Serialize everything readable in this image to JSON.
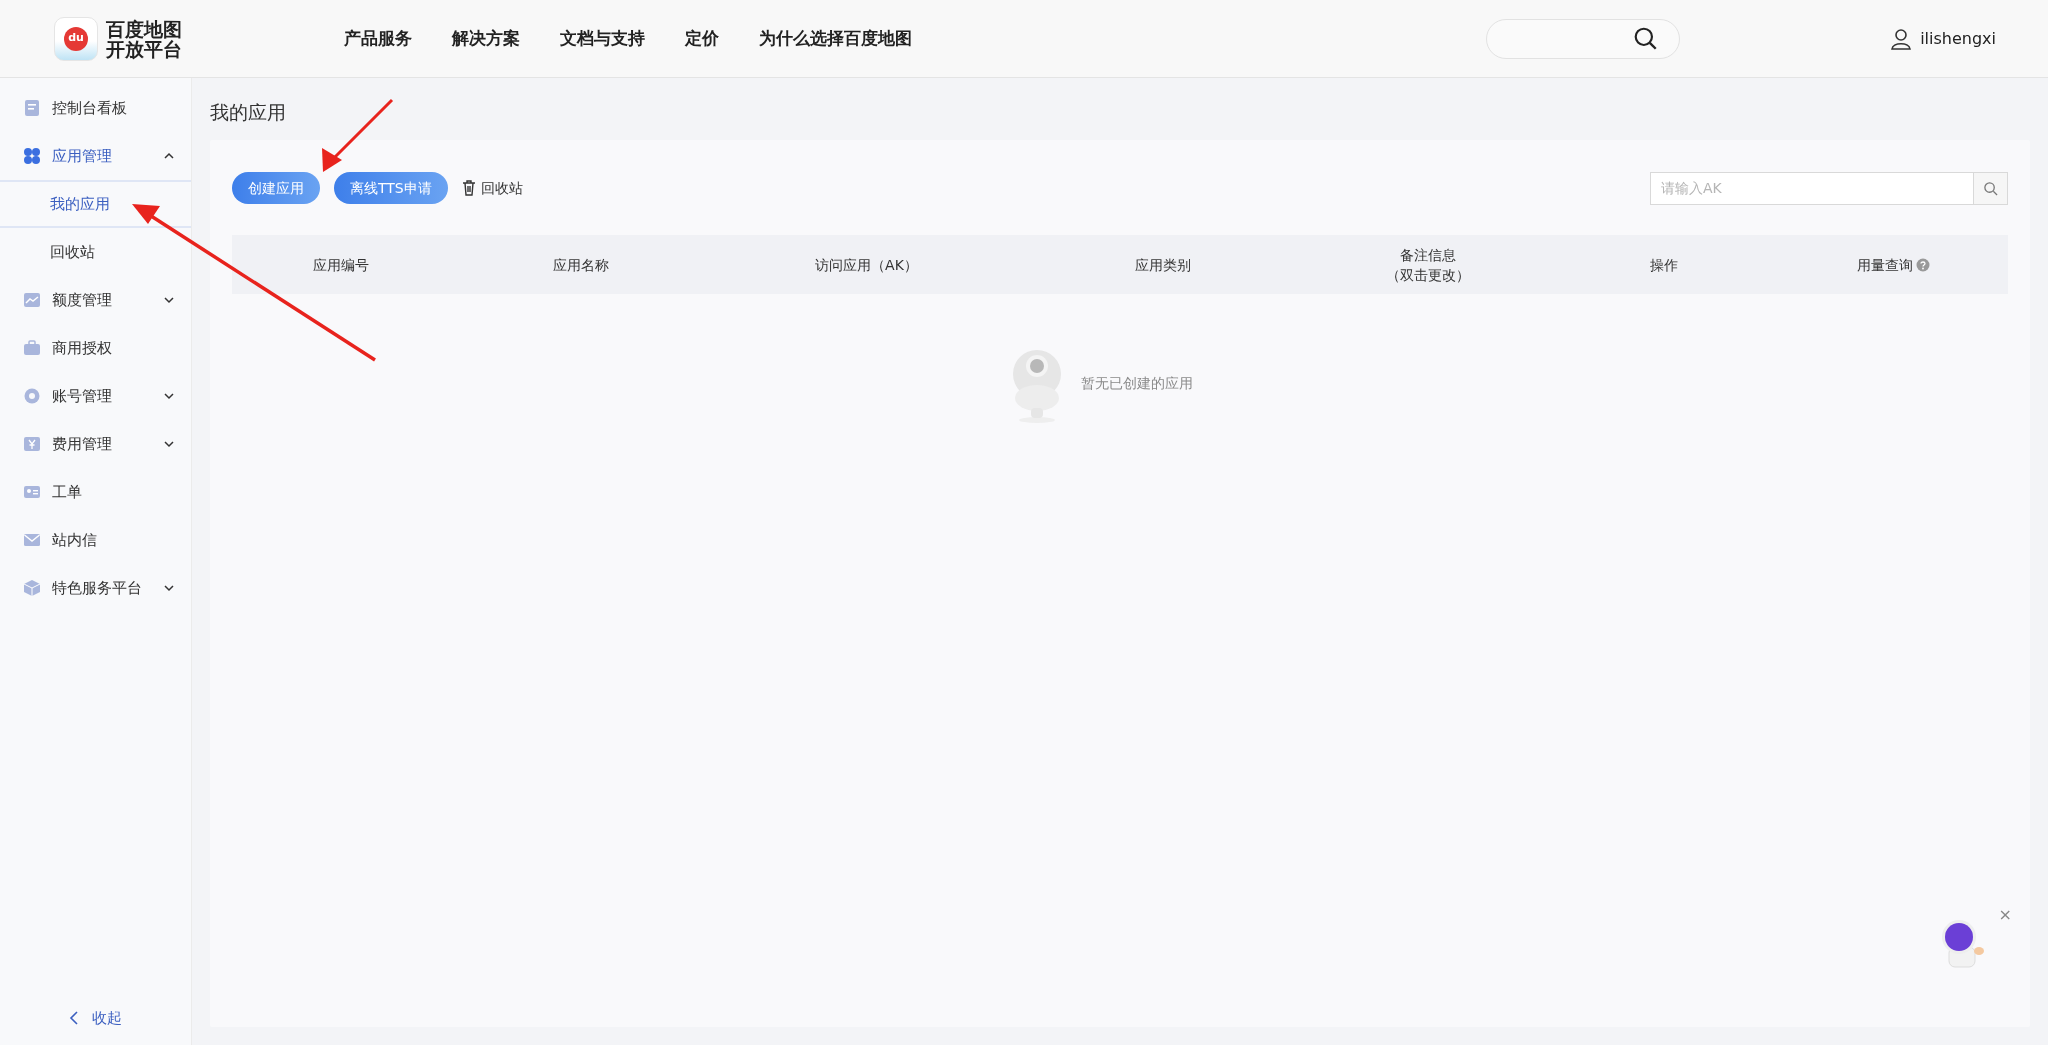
{
  "header": {
    "logo_text": [
      "百度地图",
      "开放平台"
    ],
    "logo_badge": "du",
    "nav": [
      "产品服务",
      "解决方案",
      "文档与支持",
      "定价",
      "为什么选择百度地图"
    ],
    "user": "ilishengxi"
  },
  "sidebar": {
    "items": [
      {
        "label": "控制台看板",
        "selected": false
      },
      {
        "label": "应用管理",
        "selected": true,
        "expanded": true,
        "children": [
          {
            "label": "我的应用",
            "selected": true
          },
          {
            "label": "回收站",
            "selected": false
          }
        ]
      },
      {
        "label": "额度管理",
        "selected": false,
        "expanded": false
      },
      {
        "label": "商用授权",
        "selected": false
      },
      {
        "label": "账号管理",
        "selected": false,
        "expanded": false
      },
      {
        "label": "费用管理",
        "selected": false,
        "expanded": false
      },
      {
        "label": "工单",
        "selected": false
      },
      {
        "label": "站内信",
        "selected": false
      },
      {
        "label": "特色服务平台",
        "selected": false,
        "expanded": false
      }
    ],
    "collapse": "收起"
  },
  "page": {
    "title": "我的应用",
    "toolbar": [
      {
        "kind": "primary",
        "label": "创建应用"
      },
      {
        "kind": "primary",
        "label": "离线TTS申请"
      },
      {
        "kind": "link",
        "label": "回收站"
      }
    ],
    "search": {
      "placeholder": "请输入AK"
    },
    "table": {
      "columns": [
        {
          "label": "应用编号"
        },
        {
          "label": "应用名称"
        },
        {
          "label": "访问应用（AK）"
        },
        {
          "label": "应用类别"
        },
        {
          "label": "备注信息",
          "sublabel": "（双击更改）"
        },
        {
          "label": "操作"
        },
        {
          "label": "用量查询",
          "help": true
        }
      ],
      "empty": "暂无已创建的应用"
    }
  },
  "help_widget": {
    "close": "×"
  }
}
